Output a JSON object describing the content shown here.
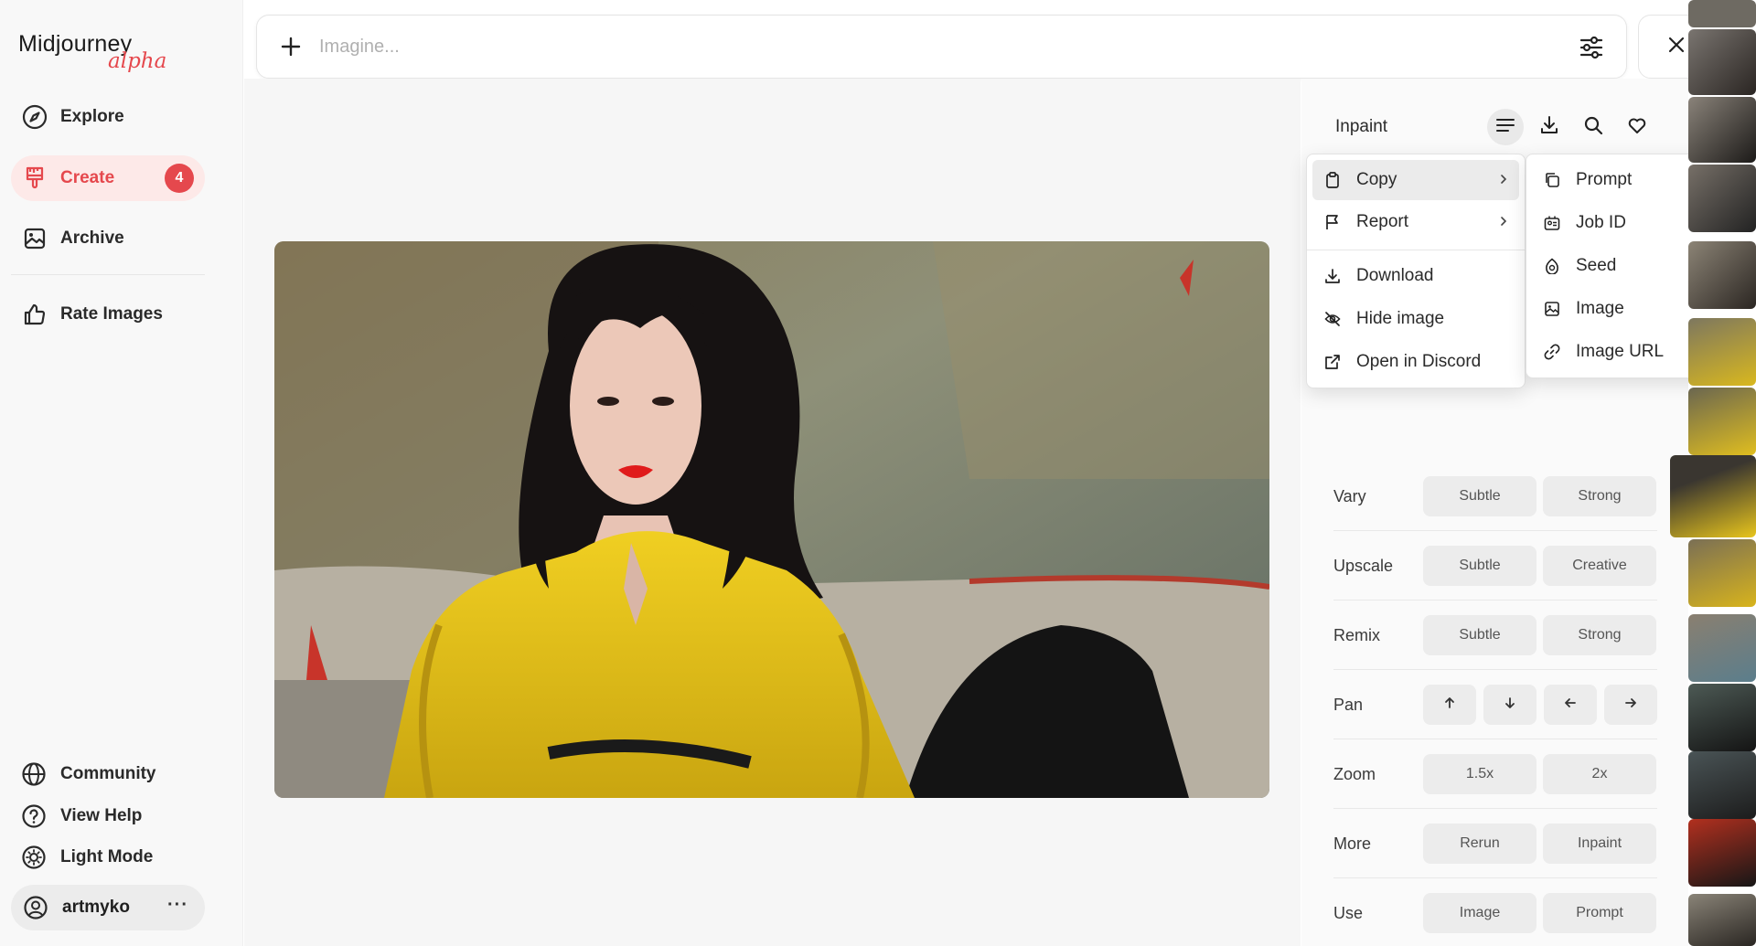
{
  "app": {
    "name": "Midjourney",
    "subtitle": "alpha"
  },
  "sidebar": {
    "nav": [
      {
        "label": "Explore",
        "icon": "compass-icon"
      },
      {
        "label": "Create",
        "icon": "brush-icon",
        "badge": "4",
        "active": true
      },
      {
        "label": "Archive",
        "icon": "image-icon"
      }
    ],
    "rate_label": "Rate Images",
    "bottom": [
      {
        "label": "Community",
        "icon": "globe-icon"
      },
      {
        "label": "View Help",
        "icon": "help-icon"
      },
      {
        "label": "Light Mode",
        "icon": "sun-icon"
      }
    ],
    "user": {
      "name": "artmyko",
      "more": "···"
    }
  },
  "prompt": {
    "placeholder": "Imagine..."
  },
  "panel": {
    "title": "Inpaint",
    "menu": {
      "items": [
        {
          "label": "Copy",
          "has_submenu": true,
          "highlighted": true
        },
        {
          "label": "Report",
          "has_submenu": true
        },
        {
          "label": "Download"
        },
        {
          "label": "Hide image"
        },
        {
          "label": "Open in Discord"
        }
      ],
      "copy_submenu": [
        "Prompt",
        "Job ID",
        "Seed",
        "Image",
        "Image URL"
      ]
    },
    "actions": [
      {
        "label": "Vary",
        "buttons": [
          "Subtle",
          "Strong"
        ]
      },
      {
        "label": "Upscale",
        "buttons": [
          "Subtle",
          "Creative"
        ]
      },
      {
        "label": "Remix",
        "buttons": [
          "Subtle",
          "Strong"
        ]
      },
      {
        "label": "Pan",
        "buttons": [
          "↑",
          "↓",
          "←",
          "→"
        ]
      },
      {
        "label": "Zoom",
        "buttons": [
          "1.5x",
          "2x"
        ]
      },
      {
        "label": "More",
        "buttons": [
          "Rerun",
          "Inpaint"
        ]
      },
      {
        "label": "Use",
        "buttons": [
          "Image",
          "Prompt"
        ]
      }
    ]
  },
  "colors": {
    "accent": "#e5484d",
    "dress": "#e8c51c"
  }
}
